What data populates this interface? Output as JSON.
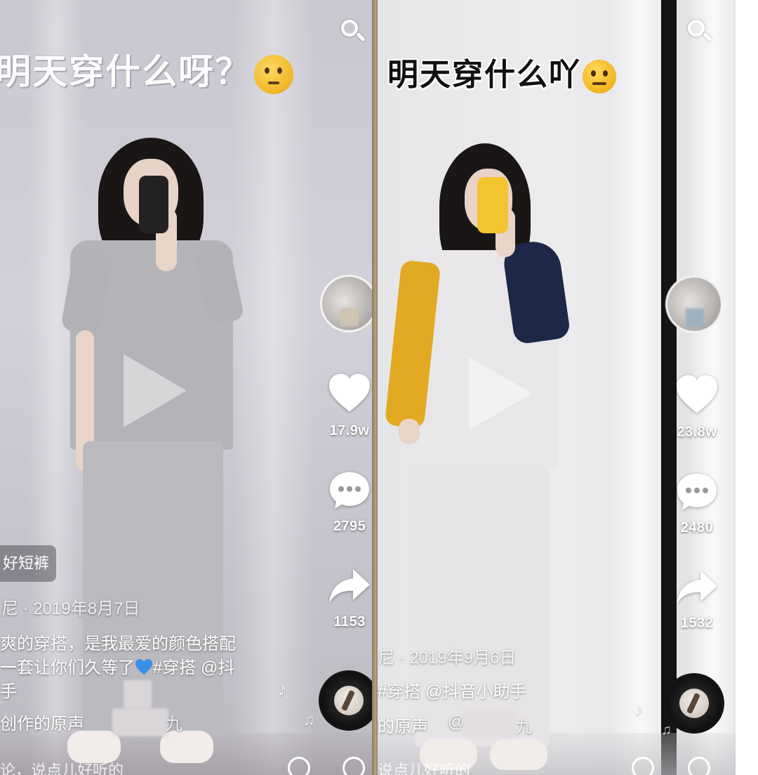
{
  "left": {
    "title": "明天穿什么呀？",
    "likes": "17.9w",
    "comments": "2795",
    "shares": "1153",
    "tag": "好短裤",
    "author_date": "尼 · 2019年8月7日",
    "caption_line1": "爽的穿搭，是我最爱的颜色搭配",
    "caption_line2_a": "一套让你们久等了",
    "caption_line2_b": "#穿搭 @抖",
    "caption_line3": "手",
    "music": "创作的原声",
    "music_author": "九",
    "bottom_hint": "论，说点儿好听的"
  },
  "right": {
    "title": "明天穿什么吖",
    "likes": "23.8w",
    "comments": "2480",
    "shares": "1532",
    "author_date": "尼 · 2019年9月6日",
    "caption": "#穿搭 @抖音小助手",
    "music": "的原声",
    "music_author_a": "@",
    "music_author_b": "九",
    "bottom_hint": "说点儿好听的"
  },
  "colors": {
    "heart": "#ffffff",
    "left_bg": "#cbc9d1",
    "right_bg": "#e8e7ea",
    "mustard_sleeve": "#e2aa23",
    "navy_sleeve": "#1d2746",
    "blue_heart": "#3a8ee8"
  },
  "icons": {
    "search": "search-icon",
    "like": "heart-icon",
    "comment": "comment-icon",
    "share": "share-icon",
    "music": "music-note-icon",
    "at": "at-icon"
  }
}
